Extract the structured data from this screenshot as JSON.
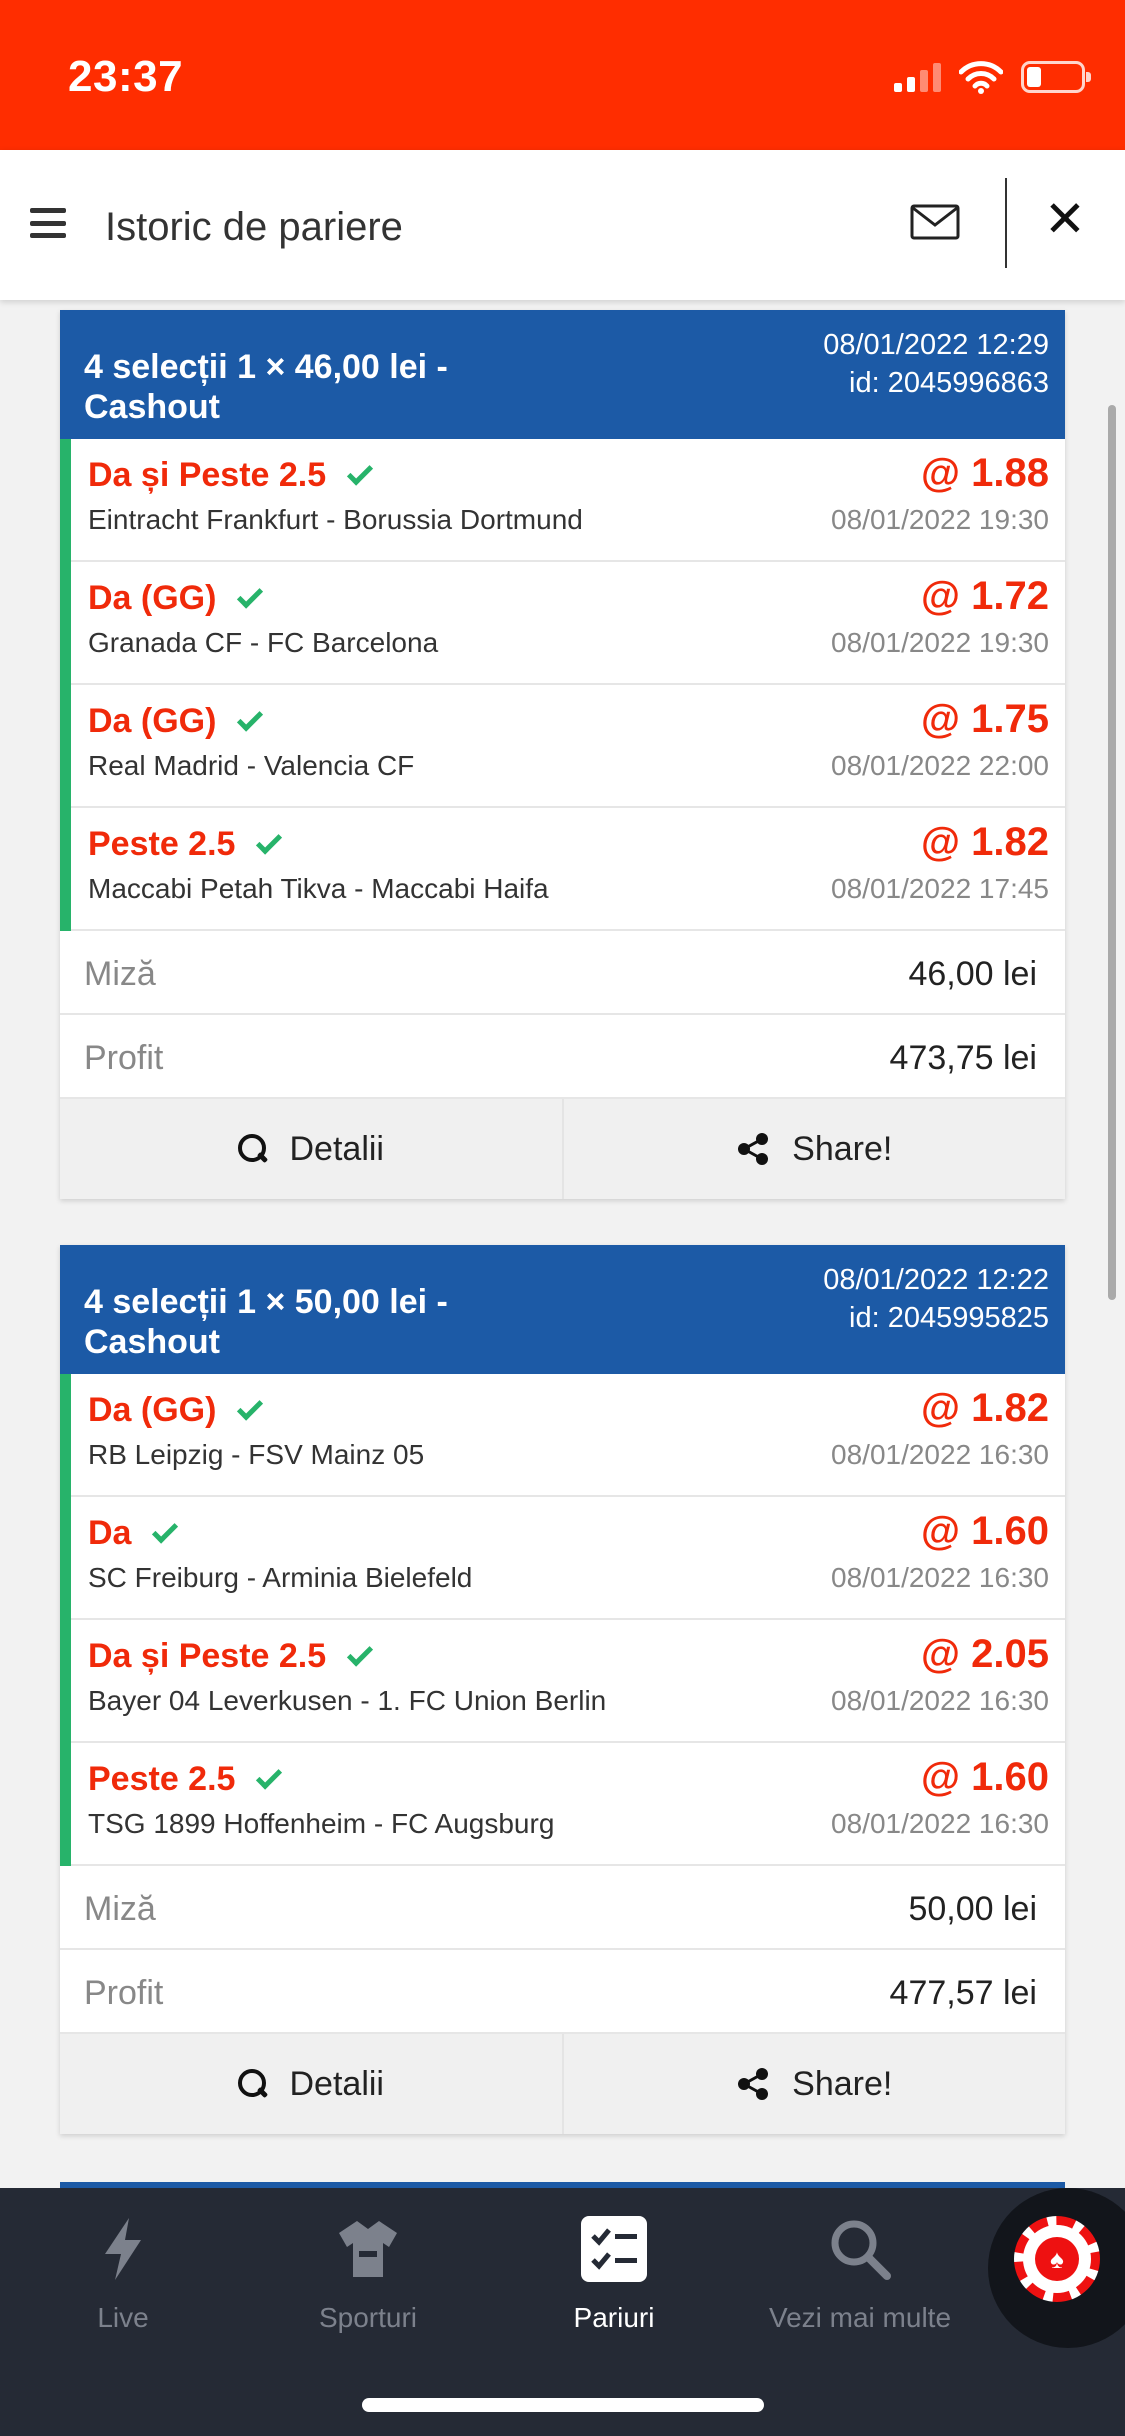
{
  "status_bar": {
    "time": "23:37"
  },
  "header": {
    "title": "Istoric de pariere"
  },
  "bets": [
    {
      "title": "4 selecții 1 × 46,00 lei - Cashout",
      "datetime": "08/01/2022 12:29",
      "id": "id: 2045996863",
      "selections": [
        {
          "pick": "Da și Peste 2.5",
          "match": "Eintracht Frankfurt - Borussia Dortmund",
          "odd": "@ 1.88",
          "date": "08/01/2022 19:30"
        },
        {
          "pick": "Da (GG)",
          "match": "Granada CF - FC Barcelona",
          "odd": "@ 1.72",
          "date": "08/01/2022 19:30"
        },
        {
          "pick": "Da (GG)",
          "match": "Real Madrid - Valencia CF",
          "odd": "@ 1.75",
          "date": "08/01/2022 22:00"
        },
        {
          "pick": "Peste 2.5",
          "match": "Maccabi Petah Tikva - Maccabi Haifa",
          "odd": "@ 1.82",
          "date": "08/01/2022 17:45"
        }
      ],
      "stake_label": "Miză",
      "stake_value": "46,00 lei",
      "profit_label": "Profit",
      "profit_value": "473,75 lei",
      "details_label": "Detalii",
      "share_label": "Share!"
    },
    {
      "title": "4 selecții 1 × 50,00 lei - Cashout",
      "datetime": "08/01/2022 12:22",
      "id": "id: 2045995825",
      "selections": [
        {
          "pick": "Da (GG)",
          "match": "RB Leipzig - FSV Mainz 05",
          "odd": "@ 1.82",
          "date": "08/01/2022 16:30"
        },
        {
          "pick": "Da",
          "match": "SC Freiburg - Arminia Bielefeld",
          "odd": "@ 1.60",
          "date": "08/01/2022 16:30"
        },
        {
          "pick": "Da și Peste 2.5",
          "match": "Bayer 04 Leverkusen - 1. FC Union Berlin",
          "odd": "@ 2.05",
          "date": "08/01/2022 16:30"
        },
        {
          "pick": "Peste 2.5",
          "match": "TSG 1899 Hoffenheim - FC Augsburg",
          "odd": "@ 1.60",
          "date": "08/01/2022 16:30"
        }
      ],
      "stake_label": "Miză",
      "stake_value": "50,00 lei",
      "profit_label": "Profit",
      "profit_value": "477,57 lei",
      "details_label": "Detalii",
      "share_label": "Share!"
    }
  ],
  "bottom_nav": {
    "items": [
      {
        "label": "Live",
        "icon": "lightning-icon",
        "active": false
      },
      {
        "label": "Sporturi",
        "icon": "jersey-icon",
        "active": false
      },
      {
        "label": "Pariuri",
        "icon": "betslip-icon",
        "active": true
      },
      {
        "label": "Vezi mai multe",
        "icon": "search-icon",
        "active": false
      }
    ],
    "casino_icon": "casino-chip-icon"
  },
  "colors": {
    "status_bar": "#ff2d00",
    "bet_header": "#1c5aa6",
    "pick_text": "#f02a0a",
    "won_accent": "#27b36a",
    "nav_bg": "#252a35"
  }
}
